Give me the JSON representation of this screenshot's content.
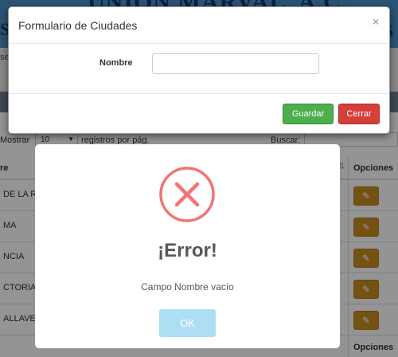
{
  "background": {
    "header_text": "UNION MARVAL, A.C.",
    "header_right_letters": "S",
    "header_left_letter": "S",
    "bar_text": "se",
    "table_controls": {
      "show_label": "Mostrar",
      "page_size": "10",
      "per_page_label": "registros por pág.",
      "search_label": "Buscar:"
    },
    "columns": {
      "name_partial": "re",
      "options": "Opciones"
    },
    "rows": [
      {
        "name_partial": "DE LA R"
      },
      {
        "name_partial": "MA"
      },
      {
        "name_partial": "NCIA"
      },
      {
        "name_partial": "CTORIA"
      },
      {
        "name_partial": "ALLAVE"
      }
    ],
    "footer_options": "Opciones",
    "edit_icon": "pencil-icon"
  },
  "form_modal": {
    "title": "Formulario de Ciudades",
    "close_glyph": "×",
    "name_label": "Nombre",
    "name_value": "",
    "save_label": "Guardar",
    "close_label": "Cerrar",
    "colors": {
      "save": "#4cae4c",
      "close": "#d43f3a"
    }
  },
  "alert": {
    "icon": "error-x-icon",
    "title": "¡Error!",
    "message": "Campo Nombre vacío",
    "ok_label": "OK",
    "colors": {
      "icon": "#f27474",
      "ok": "#aedef4"
    }
  }
}
